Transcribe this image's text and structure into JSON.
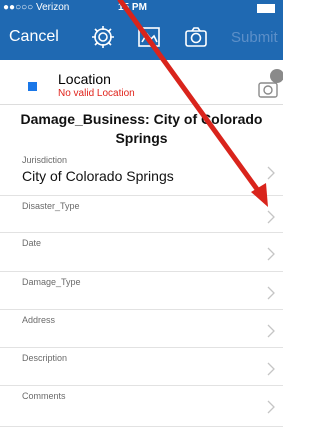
{
  "status_bar": {
    "carrier": "●●○○○ Verizon",
    "time": "15 PM"
  },
  "toolbar": {
    "cancel_label": "Cancel",
    "submit_label": "Submit"
  },
  "location": {
    "title": "Location",
    "subtitle": "No valid Location"
  },
  "form": {
    "title": "Damage_Business: City of Colorado Springs",
    "fields": [
      {
        "label": "Jurisdiction",
        "value": "City of Colorado Springs"
      },
      {
        "label": "Disaster_Type",
        "value": ""
      },
      {
        "label": "Date",
        "value": ""
      },
      {
        "label": "Damage_Type",
        "value": ""
      },
      {
        "label": "Address",
        "value": ""
      },
      {
        "label": "Description",
        "value": ""
      },
      {
        "label": "Comments",
        "value": ""
      }
    ]
  },
  "colors": {
    "header_blue": "#1f69b2",
    "location_square": "#1a77e8",
    "error_red": "#e0231b",
    "annotation_arrow": "#d9241c"
  },
  "icons": [
    "settings-gear-icon",
    "collector-map-icon",
    "camera-icon",
    "camera-badge-icon",
    "chevron-right-icon"
  ]
}
